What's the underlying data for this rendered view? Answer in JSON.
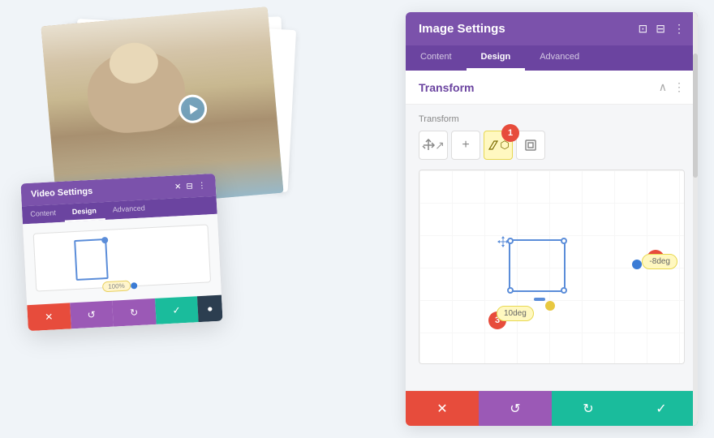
{
  "left": {
    "video_settings": {
      "title": "Video Settings",
      "header_icons": [
        "✕",
        "⊟",
        "⋮"
      ],
      "tabs": [
        {
          "label": "Content",
          "active": false
        },
        {
          "label": "Design",
          "active": true
        },
        {
          "label": "Advanced",
          "active": false
        }
      ],
      "transform_label": "100%",
      "footer_btns": [
        {
          "icon": "✕",
          "color": "red"
        },
        {
          "icon": "↺",
          "color": "purple"
        },
        {
          "icon": "↻",
          "color": "purple"
        },
        {
          "icon": "✓",
          "color": "green"
        },
        {
          "icon": "●",
          "color": "dark"
        }
      ]
    }
  },
  "right": {
    "title": "Image Settings",
    "header_icons": [
      "⊡",
      "⊟",
      "⋮"
    ],
    "tabs": [
      {
        "label": "Content",
        "active": false
      },
      {
        "label": "Design",
        "active": true
      },
      {
        "label": "Advanced",
        "active": false
      }
    ],
    "section": {
      "title": "Transform",
      "collapse_icon": "∧",
      "more_icon": "⋮"
    },
    "transform": {
      "label": "Transform",
      "tools": [
        {
          "icon": "↔",
          "tooltip": "move",
          "active": false
        },
        {
          "icon": "+",
          "tooltip": "scale",
          "active": false
        },
        {
          "icon": "◇",
          "tooltip": "skew",
          "active": true
        },
        {
          "icon": "⊞",
          "tooltip": "resize",
          "active": false
        }
      ],
      "badge_1": "1",
      "rotation_right_label": "-8deg",
      "badge_2": "2",
      "rotation_bottom_label": "10deg",
      "badge_3": "3"
    },
    "footer_btns": [
      {
        "icon": "✕",
        "color": "red",
        "label": "cancel"
      },
      {
        "icon": "↺",
        "color": "purple",
        "label": "undo"
      },
      {
        "icon": "↻",
        "color": "teal",
        "label": "redo"
      },
      {
        "icon": "✓",
        "color": "teal",
        "label": "save"
      }
    ]
  }
}
